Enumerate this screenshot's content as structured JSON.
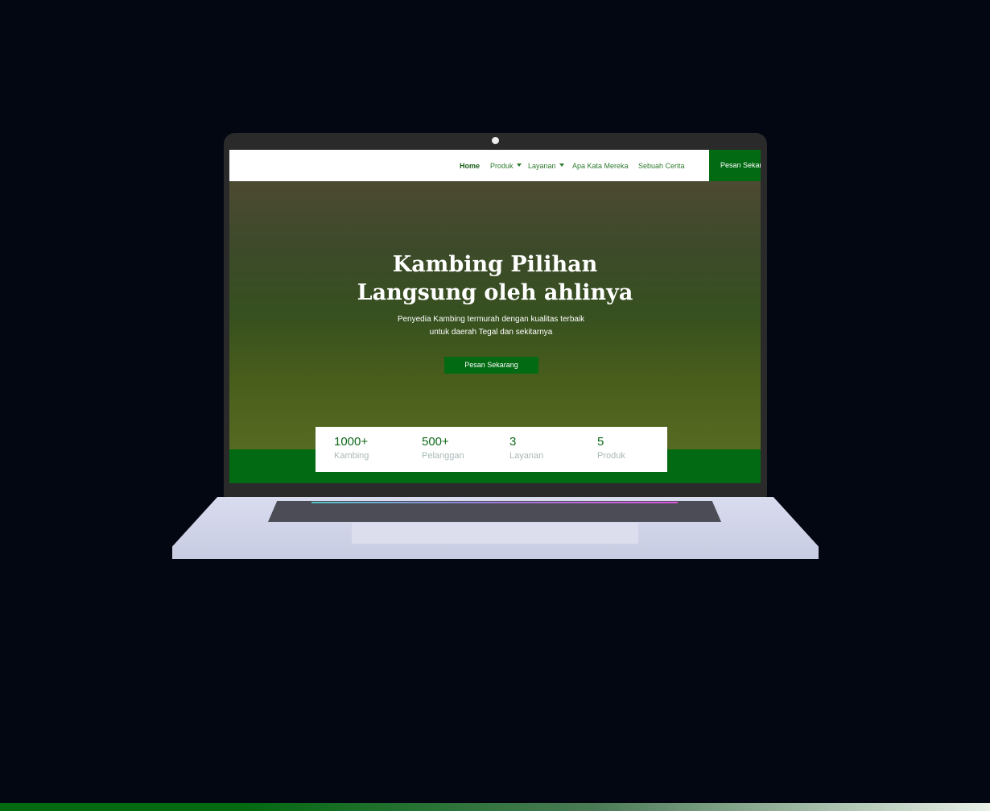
{
  "nav": {
    "items": [
      {
        "label": "Home"
      },
      {
        "label": "Produk"
      },
      {
        "label": "Layanan"
      },
      {
        "label": "Apa Kata Mereka"
      },
      {
        "label": "Sebuah Cerita"
      }
    ],
    "cta": "Pesan Sekarang"
  },
  "hero": {
    "title_line1": "Kambing Pilihan",
    "title_line2": "Langsung oleh ahlinya",
    "sub_line1": "Penyedia Kambing termurah dengan kualitas terbaik",
    "sub_line2": "untuk daerah Tegal dan sekitarnya",
    "cta": "Pesan Sekarang"
  },
  "stats": [
    {
      "value": "1000+",
      "label": "Kambing"
    },
    {
      "value": "500+",
      "label": "Pelanggan"
    },
    {
      "value": "3",
      "label": "Layanan"
    },
    {
      "value": "5",
      "label": "Produk"
    }
  ],
  "colors": {
    "brand": "#026a12"
  }
}
